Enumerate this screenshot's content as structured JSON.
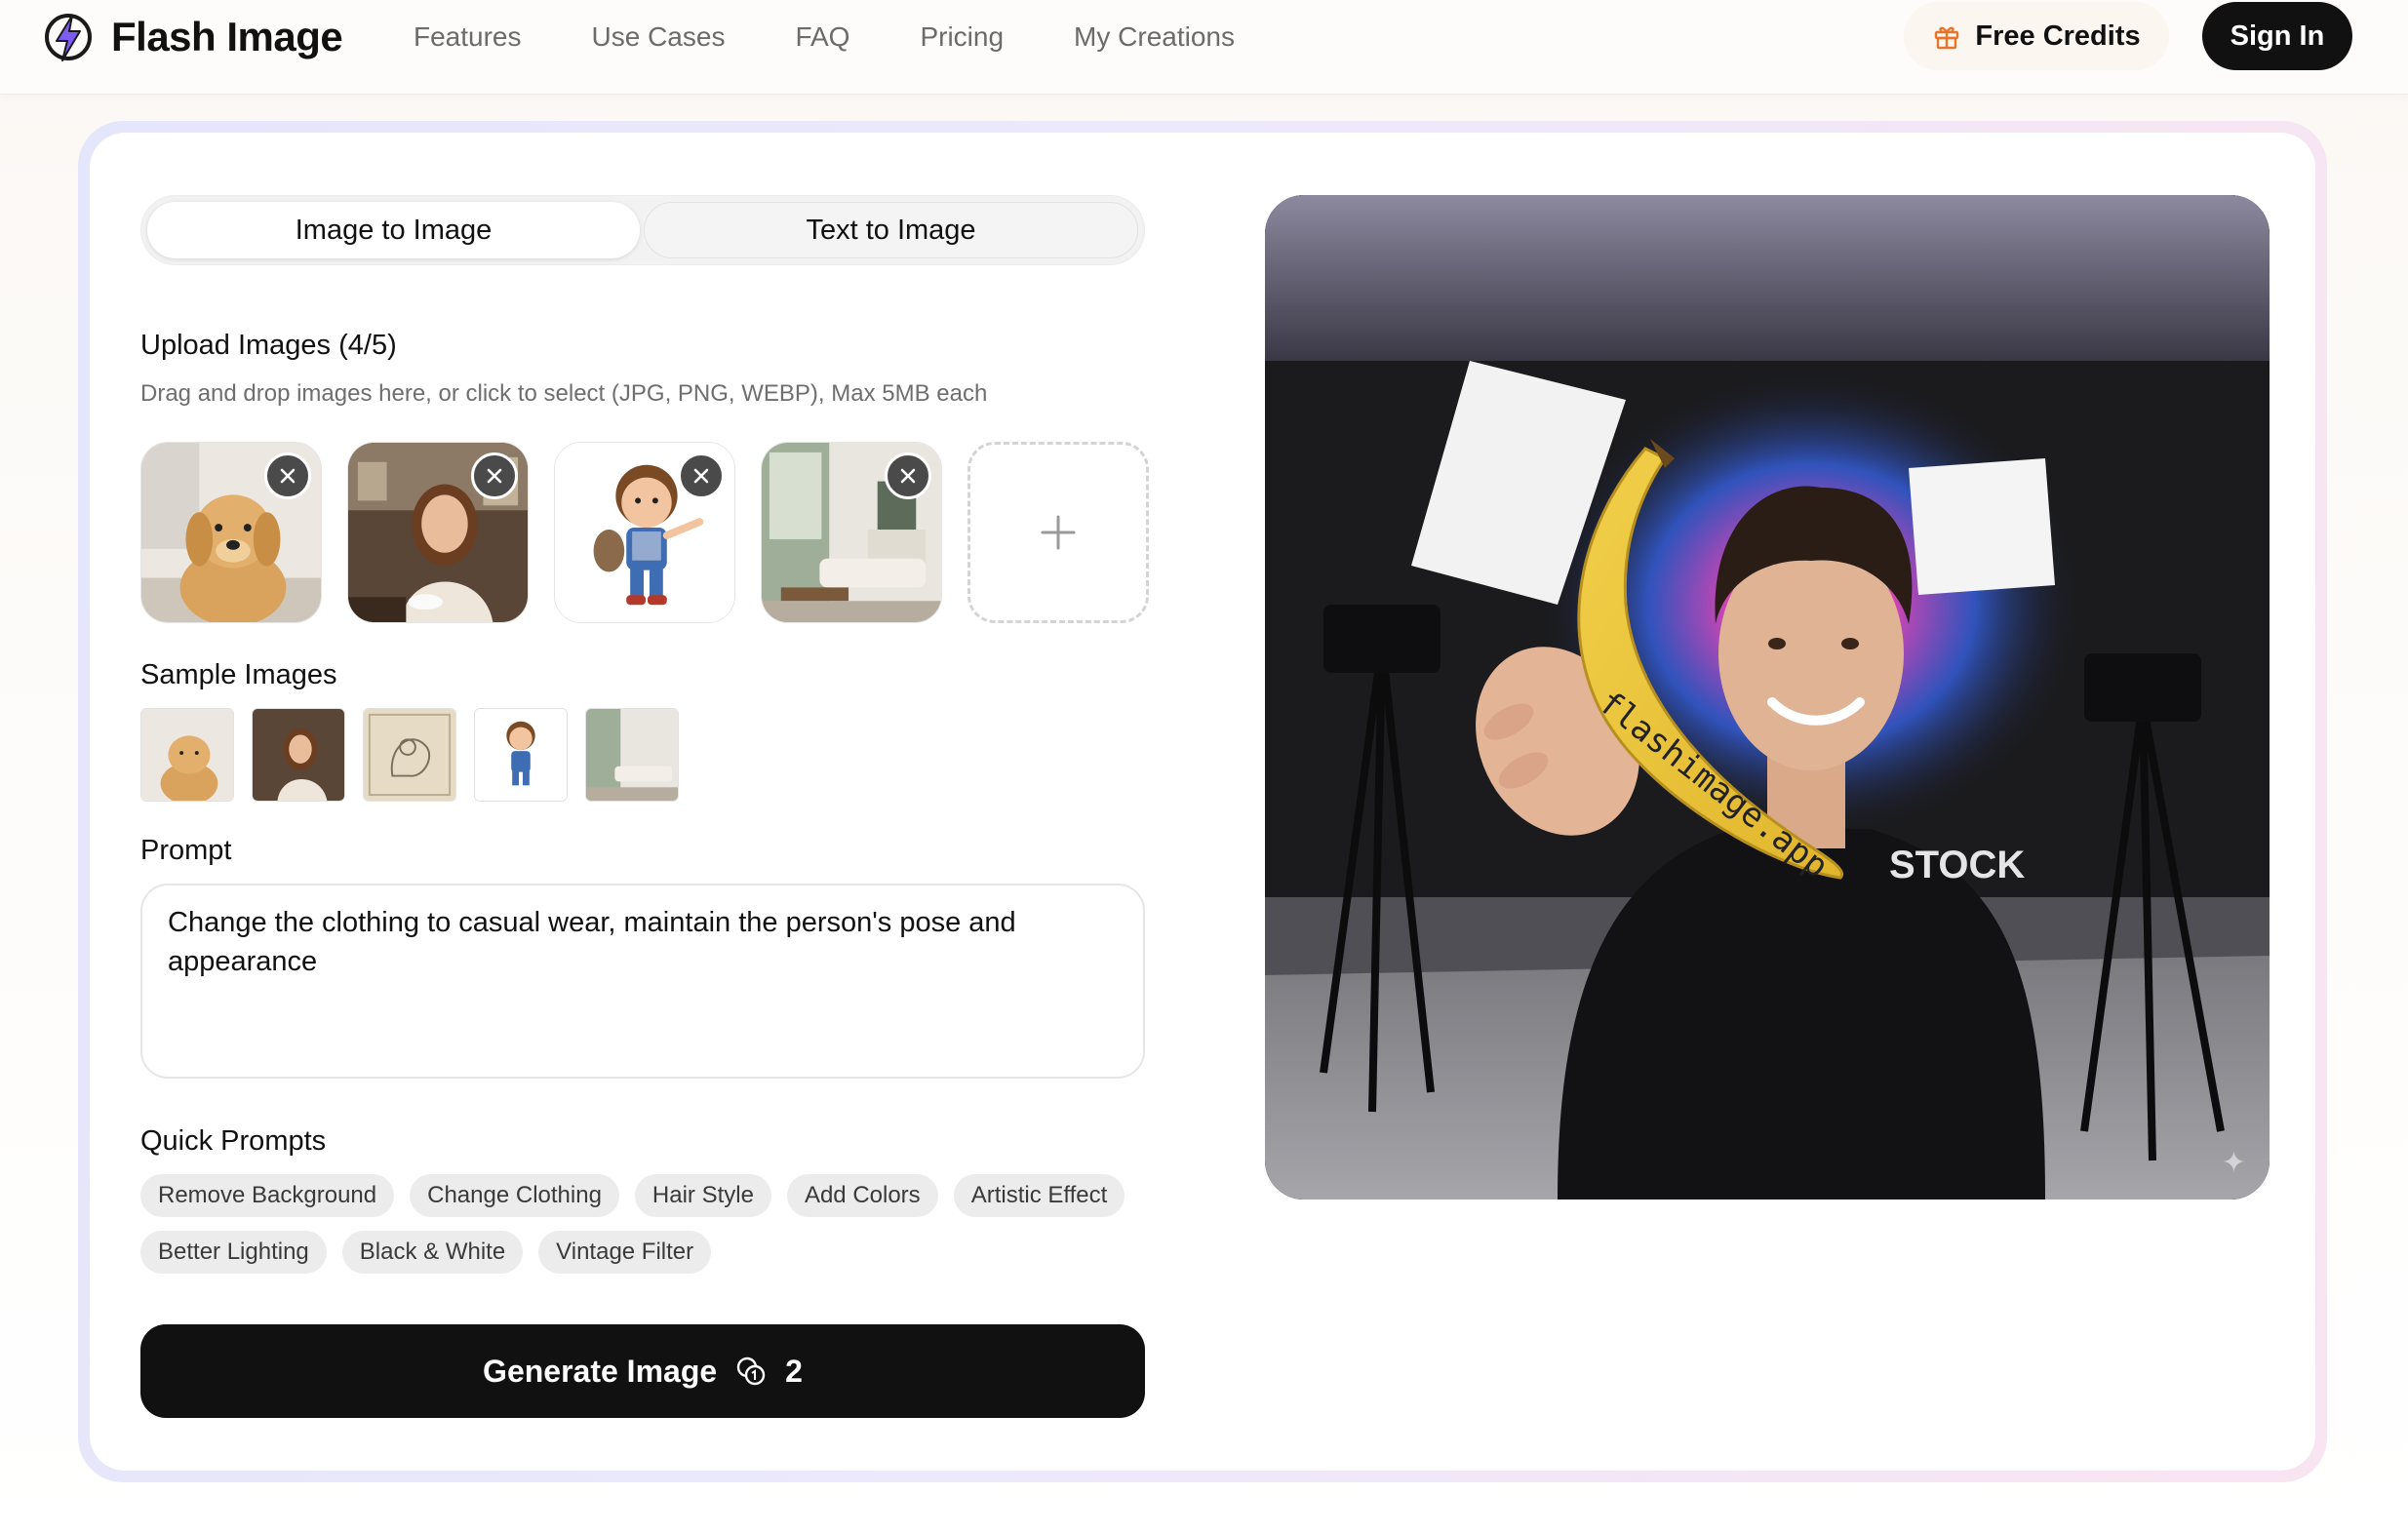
{
  "header": {
    "brand": "Flash Image",
    "nav": [
      "Features",
      "Use Cases",
      "FAQ",
      "Pricing",
      "My Creations"
    ],
    "free_credits": "Free Credits",
    "sign_in": "Sign In"
  },
  "tabs": [
    {
      "label": "Image to Image",
      "active": true
    },
    {
      "label": "Text to Image",
      "active": false
    }
  ],
  "upload": {
    "title": "Upload Images (4/5)",
    "hint": "Drag and drop images here, or click to select (JPG, PNG, WEBP), Max 5MB each",
    "add_label": "+"
  },
  "samples": {
    "title": "Sample Images"
  },
  "prompt": {
    "title": "Prompt",
    "value": "Change the clothing to casual wear, maintain the person's pose and appearance"
  },
  "quick_prompts": {
    "title": "Quick Prompts",
    "items": [
      "Remove Background",
      "Change Clothing",
      "Hair Style",
      "Add Colors",
      "Artistic Effect",
      "Better Lighting",
      "Black & White",
      "Vintage Filter"
    ]
  },
  "generate": {
    "label": "Generate Image",
    "cost": "2"
  },
  "preview": {
    "banana_text": "flashimage.app",
    "shirt_text": "STOCK"
  },
  "colors": {
    "accent": "#111111",
    "logo_bolt": "#7c5cf2",
    "gift": "#e8742a"
  }
}
